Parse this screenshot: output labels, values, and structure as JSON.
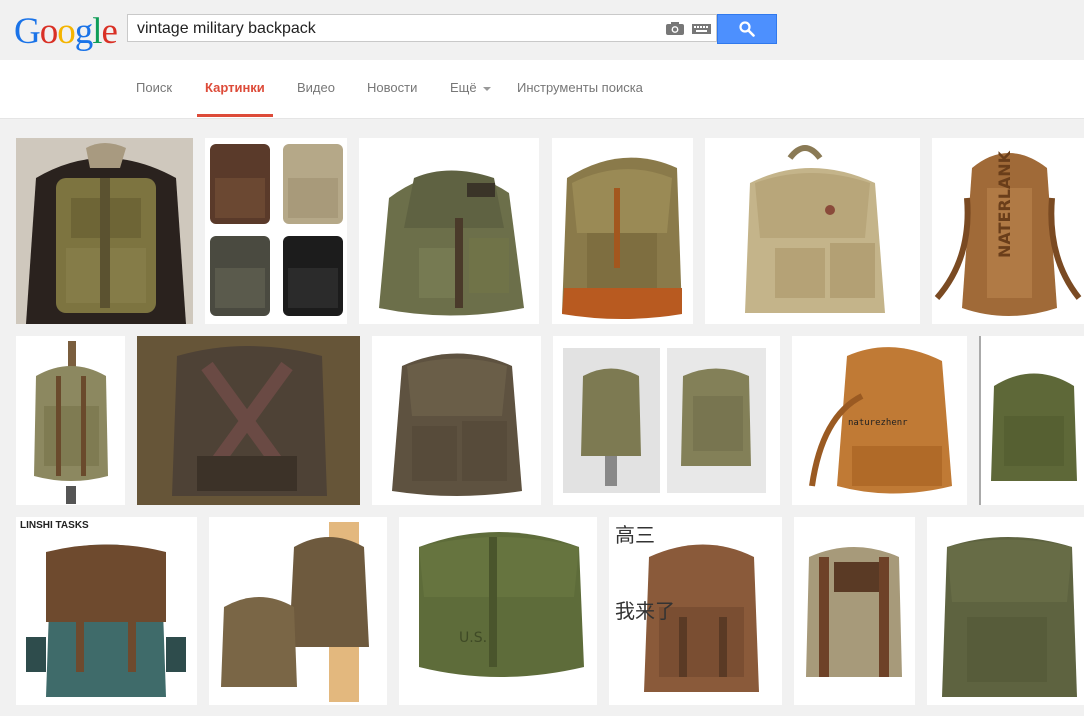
{
  "logo": {
    "letters": [
      "G",
      "o",
      "o",
      "g",
      "l",
      "e"
    ],
    "colors": [
      "#1a73e8",
      "#d93025",
      "#f4b400",
      "#1a73e8",
      "#0f9d58",
      "#d93025"
    ]
  },
  "search": {
    "query": "vintage military backpack"
  },
  "icons": {
    "camera": "camera-icon",
    "keyboard": "keyboard-icon",
    "search": "search-icon"
  },
  "nav": {
    "tabs": [
      {
        "label": "Поиск"
      },
      {
        "label": "Картинки"
      },
      {
        "label": "Видео"
      },
      {
        "label": "Новости"
      },
      {
        "label": "Ещё"
      },
      {
        "label": "Инструменты поиска"
      }
    ]
  },
  "overlays": {
    "linshi": "LINSHI TASKS",
    "naturezhenr": "naturezhenr",
    "cjk_line1": "高三",
    "cjk_line2": "我来了"
  },
  "colors": {
    "accent": "#dd4b39",
    "button": "#4d90fe"
  }
}
